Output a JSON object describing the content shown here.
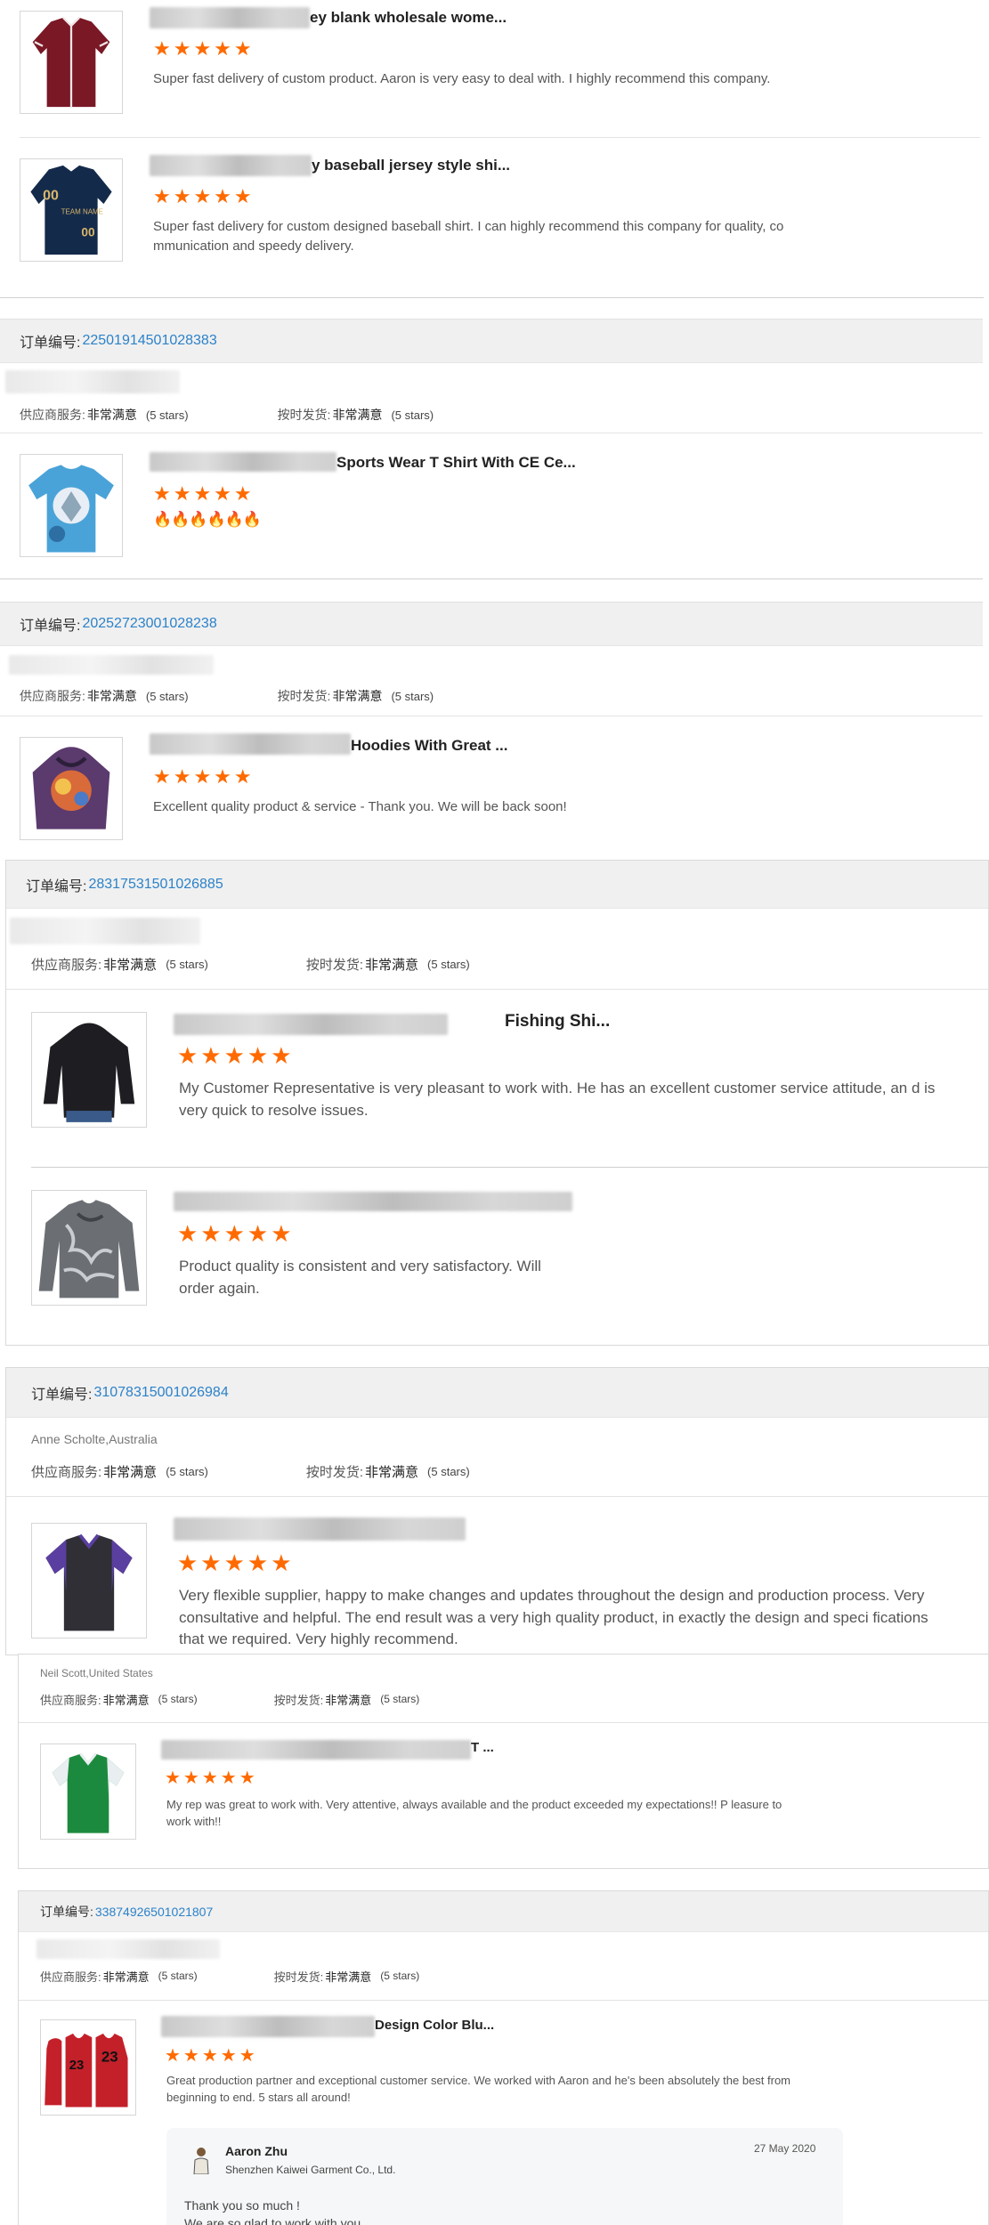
{
  "labels": {
    "order_label": "订单编号: ",
    "supplier_service": "供应商服务: ",
    "on_time_delivery": "按时发货: ",
    "very_satisfied": "非常满意",
    "five_stars": "(5 stars)",
    "stars_glyphs": "★★★★★"
  },
  "top_reviews": [
    {
      "title": "ey blank wholesale wome...",
      "thumb": "red-baseball-jersey-image",
      "review": "Super fast delivery of custom product. Aaron is very easy to deal with. I highly recommend this company."
    },
    {
      "title": "y baseball jersey style shi...",
      "thumb": "navy-team-jersey-image",
      "review": "Super fast delivery for custom designed baseball shirt. I can highly recommend this company for quality, co mmunication and speedy delivery."
    }
  ],
  "orders": [
    {
      "order_number": "22501914501028383",
      "items": [
        {
          "title": "Sports Wear T Shirt With CE Ce...",
          "thumb": "printed-tshirt-image",
          "review": "🔥🔥🔥🔥🔥🔥"
        }
      ]
    },
    {
      "order_number": "20252723001028238",
      "items": [
        {
          "title": "Hoodies With Great ...",
          "thumb": "galaxy-hoodie-image",
          "review": "Excellent quality product & service - Thank you. We will be back soon!"
        }
      ]
    },
    {
      "order_number": "28317531501026885",
      "items": [
        {
          "title": "Fishing Shi...",
          "thumb": "black-hoodie-image",
          "review": "My Customer Representative is very pleasant to work with. He has an excellent customer service attitude, an d is very quick to resolve issues."
        },
        {
          "title": "",
          "thumb": "camo-longsleeve-image",
          "review": "Product quality is consistent and very satisfactory. Will order again."
        }
      ]
    },
    {
      "order_number": "31078315001026984",
      "reviewer": "Anne Scholte,Australia",
      "items": [
        {
          "title": "",
          "thumb": "purple-polo-image",
          "review": "Very flexible supplier, happy to make changes and updates throughout the design and production process. Very consultative and helpful.  The end result was a very high quality product, in exactly the design and speci fications that we required.  Very highly recommend."
        }
      ]
    },
    {
      "reviewer": "Neil Scott,United States",
      "items": [
        {
          "title": "T ...",
          "thumb": "green-polo-image",
          "review": "My rep was great to work with. Very attentive, always available and the product exceeded my expectations!! P leasure to work with!!"
        }
      ]
    },
    {
      "order_number": "33874926501021807",
      "items": [
        {
          "title": "Design Color Blu...",
          "thumb": "red-basketball-jersey-image",
          "review": "Great production partner and exceptional customer service. We worked with Aaron and he's been absolutely the best from beginning to end. 5 stars all around!"
        }
      ],
      "reply": {
        "name": "Aaron Zhu",
        "company": "Shenzhen Kaiwei Garment Co., Ltd.",
        "date": "27 May 2020",
        "text": "Thank you so much !\nWe are so glad to work with you"
      }
    }
  ],
  "colors": {
    "accent_star": "#ff6a00",
    "order_number": "#2c82c9",
    "header_bg": "#f0f0f0"
  }
}
